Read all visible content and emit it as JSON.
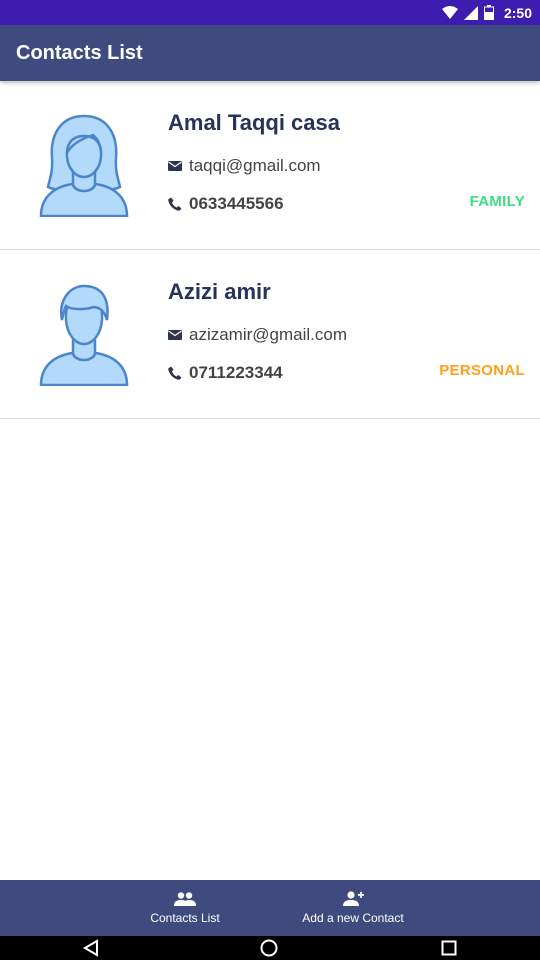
{
  "status_bar": {
    "time": "2:50"
  },
  "app_bar": {
    "title": "Contacts List"
  },
  "contacts": [
    {
      "name": "Amal Taqqi casa",
      "email": "taqqi@gmail.com",
      "phone": "0633445566",
      "category": "FAMILY",
      "category_color": "#3ddc84",
      "avatar": "female-avatar-icon"
    },
    {
      "name": "Azizi amir",
      "email": "azizamir@gmail.com",
      "phone": "0711223344",
      "category": "PERSONAL",
      "category_color": "#ff9f1a",
      "avatar": "male-avatar-icon"
    }
  ],
  "bottom_nav": {
    "items": [
      {
        "label": "Contacts List",
        "icon": "people-icon"
      },
      {
        "label": "Add a new Contact",
        "icon": "person-add-icon"
      }
    ]
  },
  "colors": {
    "status_bar": "#3d1cb0",
    "primary": "#3f4b7e",
    "name_text": "#28335c",
    "avatar_fill": "#b3d9fb",
    "avatar_stroke": "#4a86c9"
  }
}
